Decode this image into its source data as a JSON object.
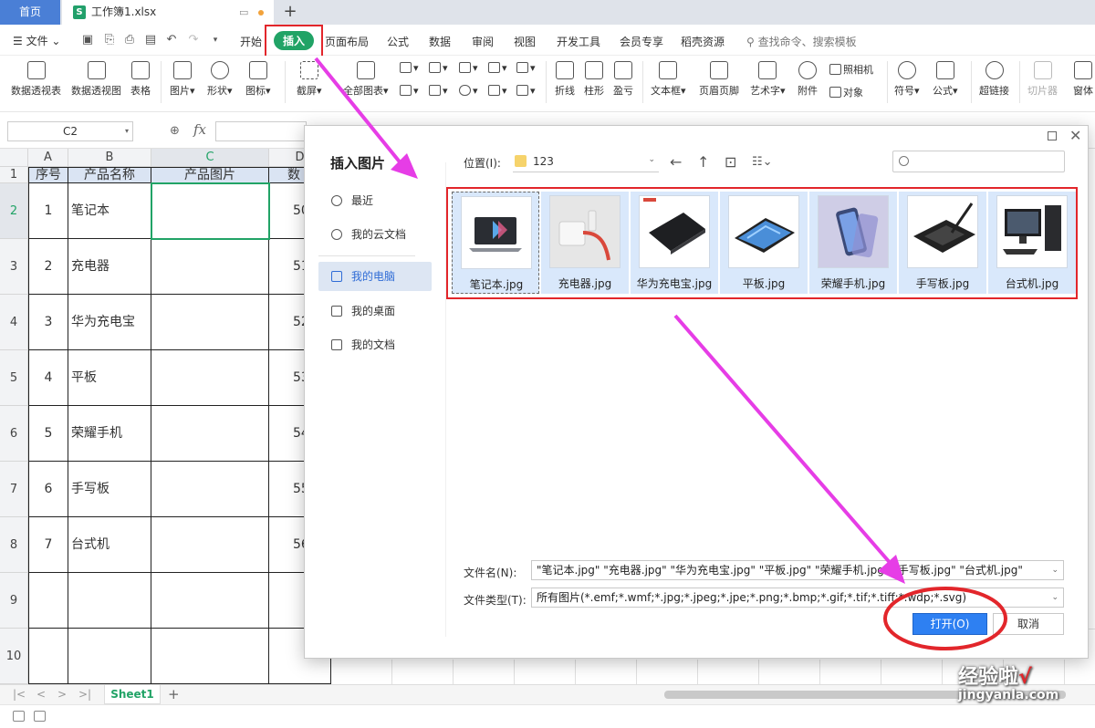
{
  "titlebar": {
    "home_tab": "首页",
    "doc_tab": "工作簿1.xlsx",
    "xls_badge": "S"
  },
  "menu": {
    "file": "文件",
    "tabs": [
      "开始",
      "插入",
      "页面布局",
      "公式",
      "数据",
      "审阅",
      "视图",
      "开发工具",
      "会员专享",
      "稻壳资源"
    ],
    "search": "查找命令、搜索模板"
  },
  "ribbon": {
    "pivot_table": "数据透视表",
    "pivot_chart": "数据透视图",
    "table": "表格",
    "picture": "图片",
    "shape": "形状",
    "icon": "图标",
    "screenshot": "截屏",
    "all_charts": "全部图表",
    "line": "折线",
    "column": "柱形",
    "winloss": "盈亏",
    "textbox": "文本框",
    "header_footer": "页眉页脚",
    "wordart": "艺术字",
    "attachment": "附件",
    "camera": "照相机",
    "object": "对象",
    "symbol": "符号",
    "formula": "公式",
    "hyperlink": "超链接",
    "slicer": "切片器",
    "window": "窗体"
  },
  "formula_bar": {
    "name_box": "C2",
    "fx": "fx"
  },
  "sheet": {
    "col_headers": [
      "A",
      "B",
      "C",
      "D"
    ],
    "row_headers": [
      "1",
      "2",
      "3",
      "4",
      "5",
      "6",
      "7",
      "8",
      "9",
      "10"
    ],
    "header_row": [
      "序号",
      "产品名称",
      "产品图片",
      "数"
    ],
    "rows": [
      {
        "no": "1",
        "name": "笔记本",
        "d": "50"
      },
      {
        "no": "2",
        "name": "充电器",
        "d": "51"
      },
      {
        "no": "3",
        "name": "华为充电宝",
        "d": "52"
      },
      {
        "no": "4",
        "name": "平板",
        "d": "53"
      },
      {
        "no": "5",
        "name": "荣耀手机",
        "d": "54"
      },
      {
        "no": "6",
        "name": "手写板",
        "d": "55"
      },
      {
        "no": "7",
        "name": "台式机",
        "d": "56"
      }
    ],
    "sheet_tab": "Sheet1"
  },
  "dialog": {
    "title": "插入图片",
    "nav": [
      "最近",
      "我的云文档",
      "我的电脑",
      "我的桌面",
      "我的文档"
    ],
    "location_label": "位置(I):",
    "location_value": "123",
    "files": [
      "笔记本.jpg",
      "充电器.jpg",
      "华为充电宝.jpg",
      "平板.jpg",
      "荣耀手机.jpg",
      "手写板.jpg",
      "台式机.jpg"
    ],
    "filename_label": "文件名(N):",
    "filename_value": "\"笔记本.jpg\" \"充电器.jpg\" \"华为充电宝.jpg\" \"平板.jpg\" \"荣耀手机.jpg\" \"手写板.jpg\" \"台式机.jpg\"",
    "filetype_label": "文件类型(T):",
    "filetype_value": "所有图片(*.emf;*.wmf;*.jpg;*.jpeg;*.jpe;*.png;*.bmp;*.gif;*.tif;*.tiff;*.wdp;*.svg)",
    "open_button": "打开(O)",
    "cancel_button": "取消"
  },
  "watermark": {
    "main": "经验啦",
    "check": "√",
    "url": "jingyanla.com"
  },
  "colors": {
    "accent_green": "#21a366",
    "annotation_red": "#e2262b",
    "annotation_magenta": "#e63de6",
    "dialog_blue": "#2e80f2"
  }
}
